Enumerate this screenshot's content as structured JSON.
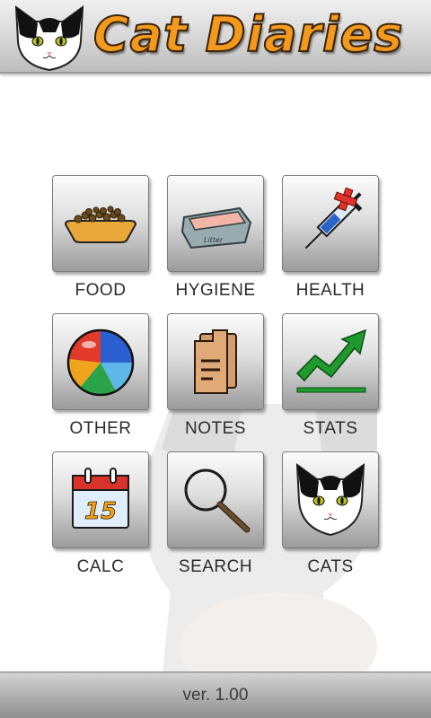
{
  "header": {
    "title": "Cat Diaries",
    "logo_icon": "cat-face-icon"
  },
  "menu": {
    "items": [
      {
        "label": "FOOD",
        "icon": "food-bowl-icon"
      },
      {
        "label": "HYGIENE",
        "icon": "litter-box-icon"
      },
      {
        "label": "HEALTH",
        "icon": "syringe-icon"
      },
      {
        "label": "OTHER",
        "icon": "ball-icon"
      },
      {
        "label": "NOTES",
        "icon": "notes-icon"
      },
      {
        "label": "STATS",
        "icon": "stats-arrow-icon"
      },
      {
        "label": "CALC",
        "icon": "calendar-icon"
      },
      {
        "label": "SEARCH",
        "icon": "magnifier-icon"
      },
      {
        "label": "CATS",
        "icon": "cat-face-icon"
      }
    ],
    "calendar_day": "15",
    "litter_text": "Litter"
  },
  "footer": {
    "version": "ver. 1.00"
  },
  "colors": {
    "title_orange": "#f39a1e",
    "health_red": "#e0342b",
    "stats_green": "#1f9a2c"
  }
}
